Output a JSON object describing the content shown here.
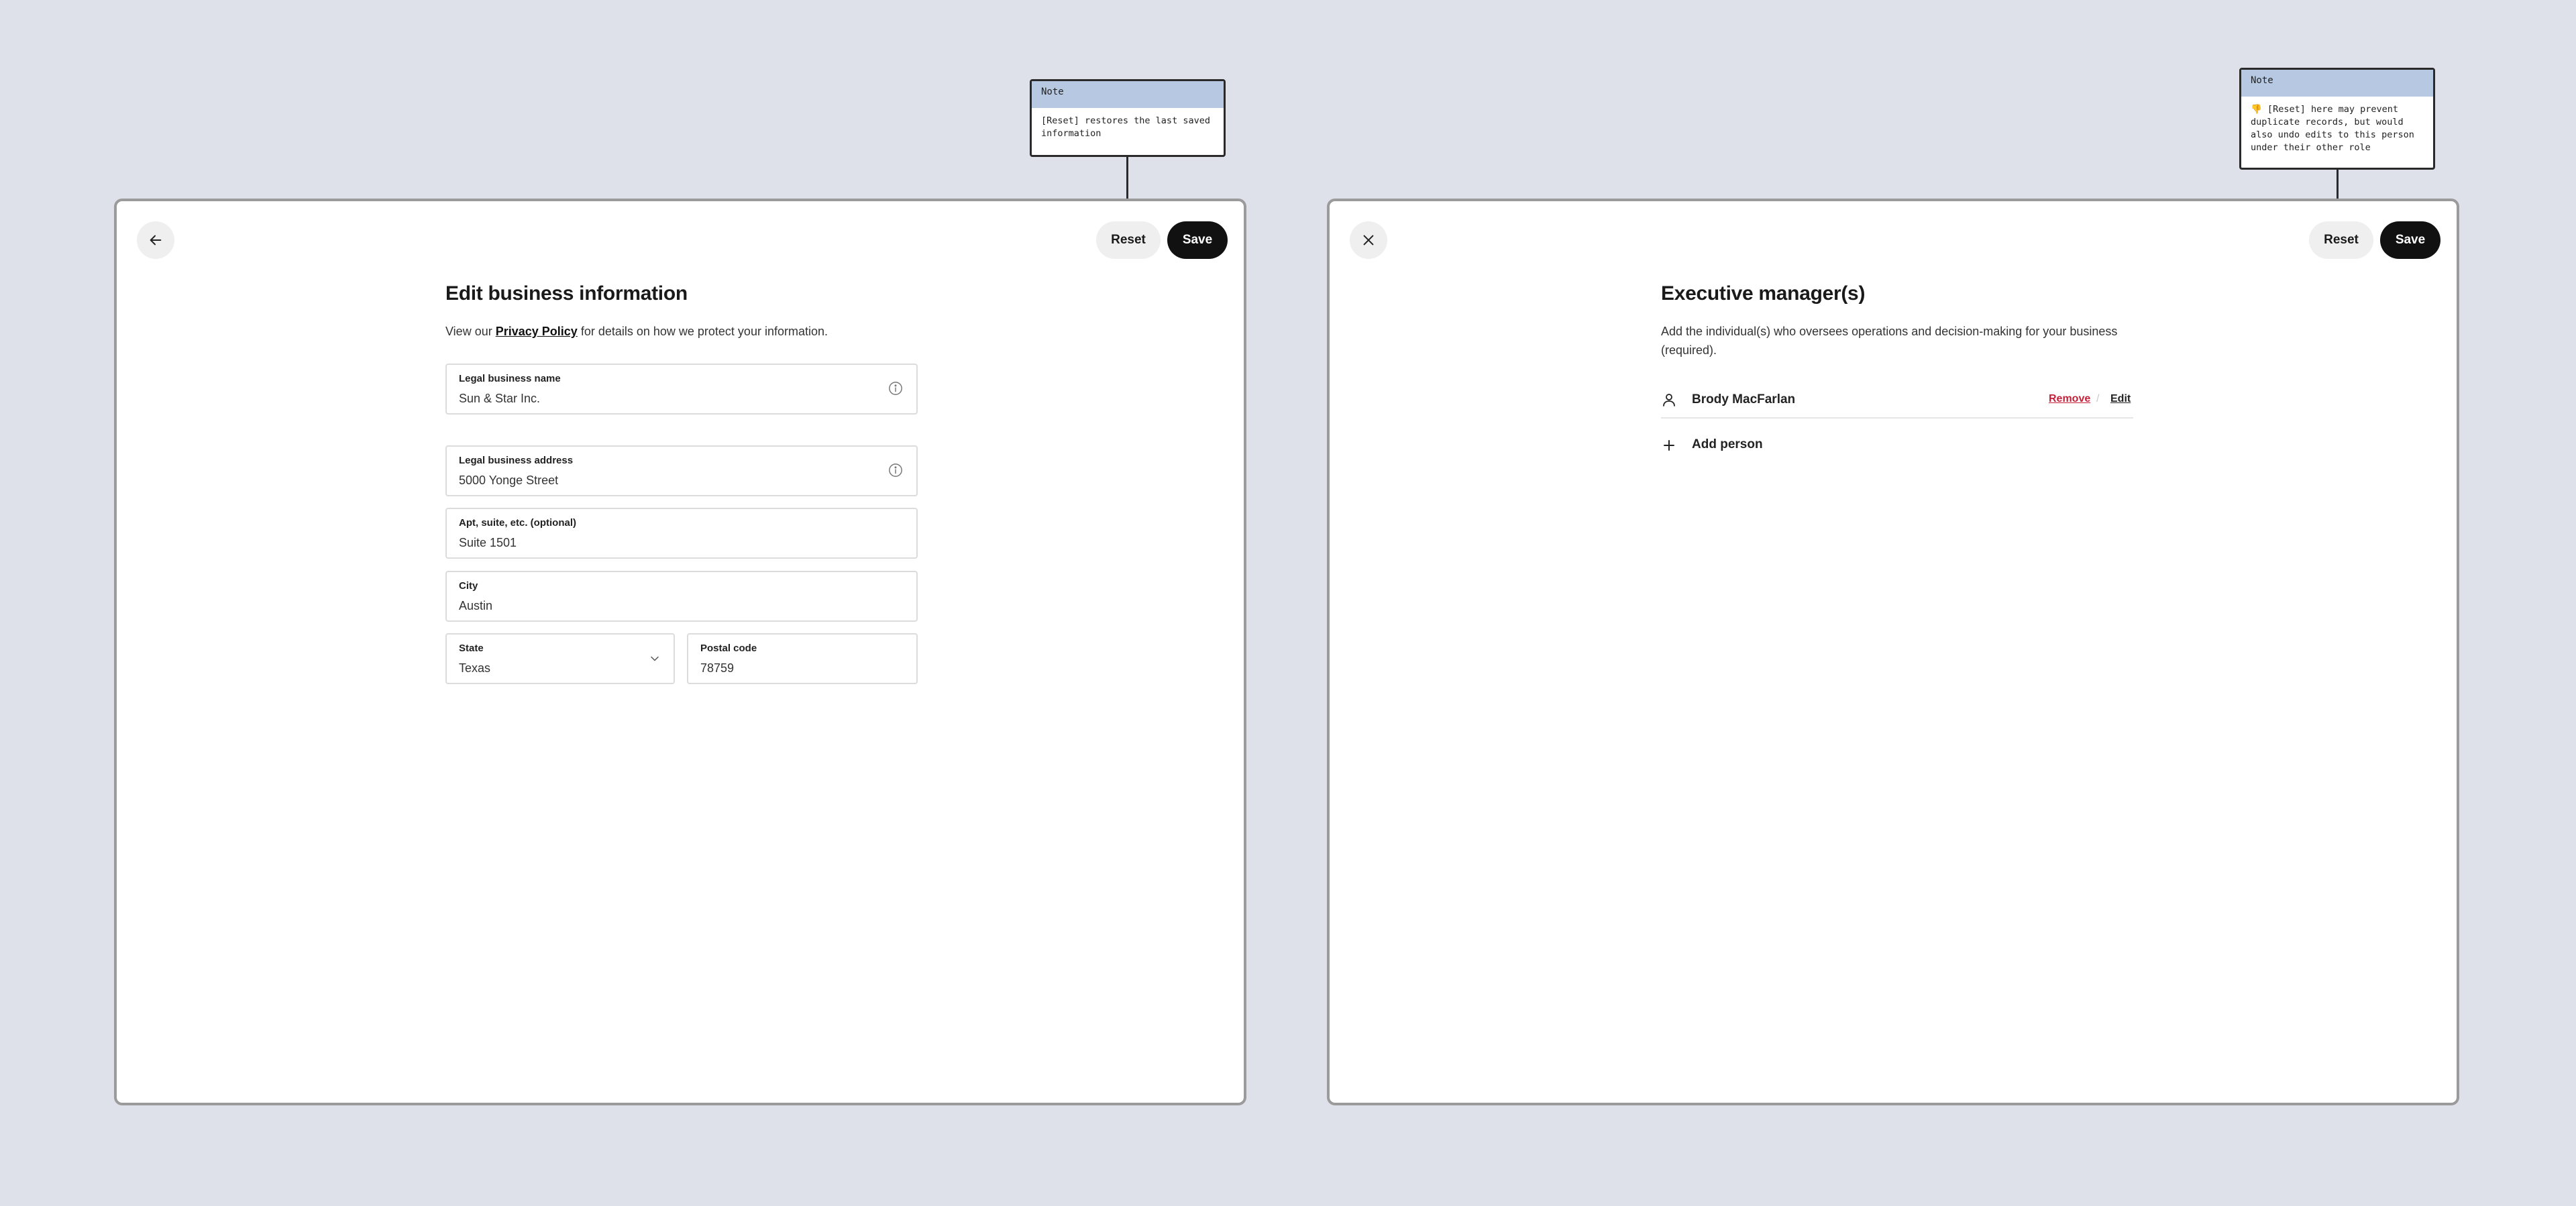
{
  "left_panel": {
    "reset_label": "Reset",
    "save_label": "Save",
    "title": "Edit business information",
    "desc_before": "View our ",
    "desc_link": "Privacy Policy",
    "desc_after": " for details on how we protect your information.",
    "fields": {
      "legal_name": {
        "label": "Legal business name",
        "value": "Sun & Star Inc."
      },
      "legal_address": {
        "label": "Legal business address",
        "value": "5000 Yonge Street"
      },
      "apt": {
        "label": "Apt, suite, etc. (optional)",
        "value": "Suite 1501"
      },
      "city": {
        "label": "City",
        "value": "Austin"
      },
      "state": {
        "label": "State",
        "value": "Texas"
      },
      "postal": {
        "label": "Postal code",
        "value": "78759"
      }
    }
  },
  "right_panel": {
    "reset_label": "Reset",
    "save_label": "Save",
    "title": "Executive manager(s)",
    "desc": "Add the individual(s) who oversees operations and decision-making for your business (required).",
    "person": {
      "name": "Brody MacFarlan",
      "remove_label": "Remove",
      "separator": "/",
      "edit_label": "Edit"
    },
    "add_label": "Add person"
  },
  "notes": {
    "left": {
      "header": "Note",
      "body": "[Reset] restores the last saved information"
    },
    "right": {
      "header": "Note",
      "body": "👎 [Reset] here may prevent duplicate records, but would also undo edits to this person under their other role"
    }
  },
  "icons": {
    "back": "arrow-left-icon",
    "close": "close-icon",
    "info": "info-icon",
    "chevron": "chevron-down-icon",
    "person": "person-icon",
    "plus": "plus-icon"
  },
  "colors": {
    "background": "#dfe1ea",
    "save_button": "#111111",
    "reset_button": "#efefef",
    "remove_link": "#c4213a",
    "note_header": "#b7c9e2"
  }
}
